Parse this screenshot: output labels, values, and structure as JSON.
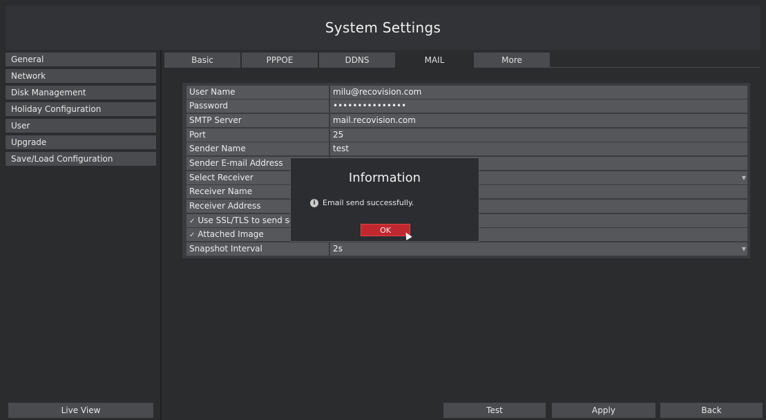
{
  "header": {
    "title": "System Settings"
  },
  "sidebar": {
    "items": [
      {
        "label": "General"
      },
      {
        "label": "Network"
      },
      {
        "label": "Disk Management"
      },
      {
        "label": "Holiday Configuration"
      },
      {
        "label": "User"
      },
      {
        "label": "Upgrade"
      },
      {
        "label": "Save/Load Configuration"
      }
    ],
    "live_view_label": "Live View"
  },
  "tabs": [
    {
      "label": "Basic"
    },
    {
      "label": "PPPOE"
    },
    {
      "label": "DDNS"
    },
    {
      "label": "MAIL",
      "active": true
    },
    {
      "label": "More"
    }
  ],
  "form": {
    "user_name": {
      "label": "User Name",
      "value": "milu@recovision.com"
    },
    "password": {
      "label": "Password",
      "value": "•••••••••••••••"
    },
    "smtp_server": {
      "label": "SMTP Server",
      "value": "mail.recovision.com"
    },
    "port": {
      "label": "Port",
      "value": "25"
    },
    "sender_name": {
      "label": "Sender Name",
      "value": "test"
    },
    "sender_email": {
      "label": "Sender E-mail Address",
      "value": ""
    },
    "select_receiver": {
      "label": "Select Receiver",
      "value": ""
    },
    "receiver_name": {
      "label": "Receiver Name",
      "value": ""
    },
    "receiver_address": {
      "label": "Receiver Address",
      "value": ""
    },
    "use_ssl": {
      "label": "Use SSL/TLS to send secu",
      "checked": true
    },
    "attached_image": {
      "label": "Attached Image",
      "checked": true
    },
    "snapshot_interval": {
      "label": "Snapshot Interval",
      "value": "2s"
    }
  },
  "buttons": {
    "test": "Test",
    "apply": "Apply",
    "back": "Back"
  },
  "dialog": {
    "title": "Information",
    "message": "Email send successfully.",
    "ok_label": "OK"
  },
  "colors": {
    "accent": "#c0282f",
    "background": "#2b2c2e"
  }
}
